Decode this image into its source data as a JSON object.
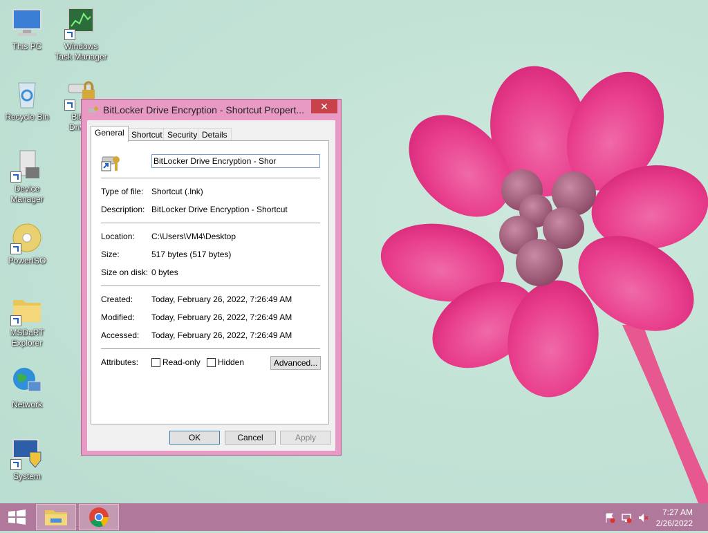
{
  "desktop": {
    "icons": [
      {
        "label_lines": [
          "This PC"
        ]
      },
      {
        "label_lines": [
          "Windows",
          "Task Manager"
        ]
      },
      {
        "label_lines": [
          "Recycle Bin"
        ]
      },
      {
        "label_lines": [
          "BitLo",
          "Drive l"
        ]
      },
      {
        "label_lines": [
          "Device",
          "Manager"
        ]
      },
      {
        "label_lines": [
          "PowerISO"
        ]
      },
      {
        "label_lines": [
          "MSDaRT",
          "Explorer"
        ]
      },
      {
        "label_lines": [
          "Network"
        ]
      },
      {
        "label_lines": [
          "System"
        ]
      }
    ]
  },
  "window": {
    "title": "BitLocker Drive Encryption - Shortcut Propert...",
    "close_label": "✕",
    "tabs": [
      "General",
      "Shortcut",
      "Security",
      "Details"
    ],
    "active_tab": "General",
    "name_value": "BitLocker Drive Encryption - Shor",
    "fields": {
      "type_label": "Type of file:",
      "type_value": "Shortcut (.lnk)",
      "desc_label": "Description:",
      "desc_value": "BitLocker Drive Encryption - Shortcut",
      "location_label": "Location:",
      "location_value": "C:\\Users\\VM4\\Desktop",
      "size_label": "Size:",
      "size_value": "517 bytes (517 bytes)",
      "sizeondisk_label": "Size on disk:",
      "sizeondisk_value": "0 bytes",
      "created_label": "Created:",
      "created_value": "Today, February 26, 2022, 7:26:49 AM",
      "modified_label": "Modified:",
      "modified_value": "Today, February 26, 2022, 7:26:49 AM",
      "accessed_label": "Accessed:",
      "accessed_value": "Today, February 26, 2022, 7:26:49 AM",
      "attributes_label": "Attributes:",
      "readonly_label": "Read-only",
      "hidden_label": "Hidden",
      "advanced_label": "Advanced..."
    },
    "buttons": {
      "ok": "OK",
      "cancel": "Cancel",
      "apply": "Apply"
    }
  },
  "taskbar": {
    "time": "7:27 AM",
    "date": "2/26/2022"
  },
  "colors": {
    "titlebar": "#e89ac4",
    "taskbar": "#b0789a",
    "close_button": "#c7424b"
  }
}
